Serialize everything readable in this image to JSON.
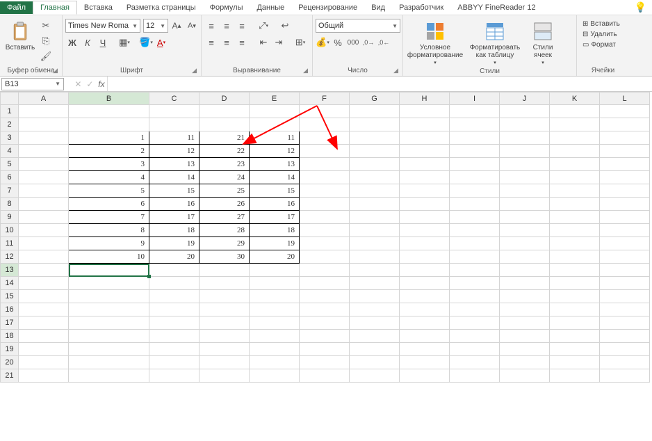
{
  "tabs": {
    "file": "Файл",
    "items": [
      "Главная",
      "Вставка",
      "Разметка страницы",
      "Формулы",
      "Данные",
      "Рецензирование",
      "Вид",
      "Разработчик",
      "ABBYY FineReader 12"
    ]
  },
  "ribbon": {
    "clipboard": {
      "paste": "Вставить",
      "label": "Буфер обмена"
    },
    "font": {
      "name": "Times New Roma",
      "size": "12",
      "label": "Шрифт",
      "bold": "Ж",
      "italic": "К",
      "underline": "Ч"
    },
    "alignment": {
      "label": "Выравнивание"
    },
    "number": {
      "label": "Число",
      "format": "Общий"
    },
    "styles": {
      "label": "Стили",
      "conditional": "Условное форматирование",
      "formatTable": "Форматировать как таблицу",
      "cellStyles": "Стили ячеек"
    },
    "cells": {
      "label": "Ячейки",
      "insert": "Вставить",
      "delete": "Удалить",
      "format": "Формат"
    }
  },
  "nameBox": "B13",
  "columns": [
    "A",
    "B",
    "C",
    "D",
    "E",
    "F",
    "G",
    "H",
    "I",
    "J",
    "K",
    "L"
  ],
  "rowCount": 21,
  "dataStart": 3,
  "dataEnd": 12,
  "dataCols": [
    "B",
    "C",
    "D",
    "E"
  ],
  "chart_data": {
    "type": "table",
    "rows": [
      {
        "B": 1,
        "C": 11,
        "D": 21,
        "E": 11
      },
      {
        "B": 2,
        "C": 12,
        "D": 22,
        "E": 12
      },
      {
        "B": 3,
        "C": 13,
        "D": 23,
        "E": 13
      },
      {
        "B": 4,
        "C": 14,
        "D": 24,
        "E": 14
      },
      {
        "B": 5,
        "C": 15,
        "D": 25,
        "E": 15
      },
      {
        "B": 6,
        "C": 16,
        "D": 26,
        "E": 16
      },
      {
        "B": 7,
        "C": 17,
        "D": 27,
        "E": 17
      },
      {
        "B": 8,
        "C": 18,
        "D": 28,
        "E": 18
      },
      {
        "B": 9,
        "C": 19,
        "D": 29,
        "E": 19
      },
      {
        "B": 10,
        "C": 20,
        "D": 30,
        "E": 20
      }
    ]
  },
  "selectedCell": {
    "row": 13,
    "col": "B"
  }
}
